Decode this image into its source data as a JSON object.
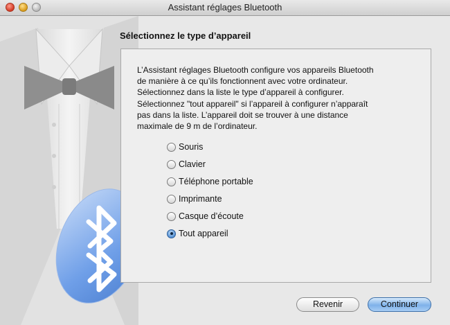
{
  "window": {
    "title": "Assistant réglages Bluetooth"
  },
  "content": {
    "heading": "Sélectionnez le type d’appareil",
    "description_lines": [
      "L’Assistant réglages Bluetooth configure vos appareils Bluetooth",
      "de manière à ce qu’ils fonctionnent avec votre ordinateur.",
      "Sélectionnez dans la liste le type d’appareil à configurer.",
      "Sélectionnez \"tout appareil\" si l’appareil à configurer n’apparaît",
      "pas dans la liste. L’appareil doit se trouver à une distance",
      "maximale de 9 m de l’ordinateur."
    ],
    "options": [
      {
        "label": "Souris",
        "selected": false
      },
      {
        "label": "Clavier",
        "selected": false
      },
      {
        "label": "Téléphone portable",
        "selected": false
      },
      {
        "label": "Imprimante",
        "selected": false
      },
      {
        "label": "Casque d’écoute",
        "selected": false
      },
      {
        "label": "Tout appareil",
        "selected": true
      }
    ]
  },
  "buttons": {
    "back": "Revenir",
    "continue": "Continuer"
  },
  "icons": {
    "window_controls": [
      "close-icon",
      "minimize-icon",
      "zoom-icon"
    ],
    "artwork": "tuxedo-bowtie-illustration",
    "logo": "bluetooth-icon"
  },
  "colors": {
    "accent": "#5a9ae0",
    "bluetooth_badge": "#6f9fe8"
  }
}
